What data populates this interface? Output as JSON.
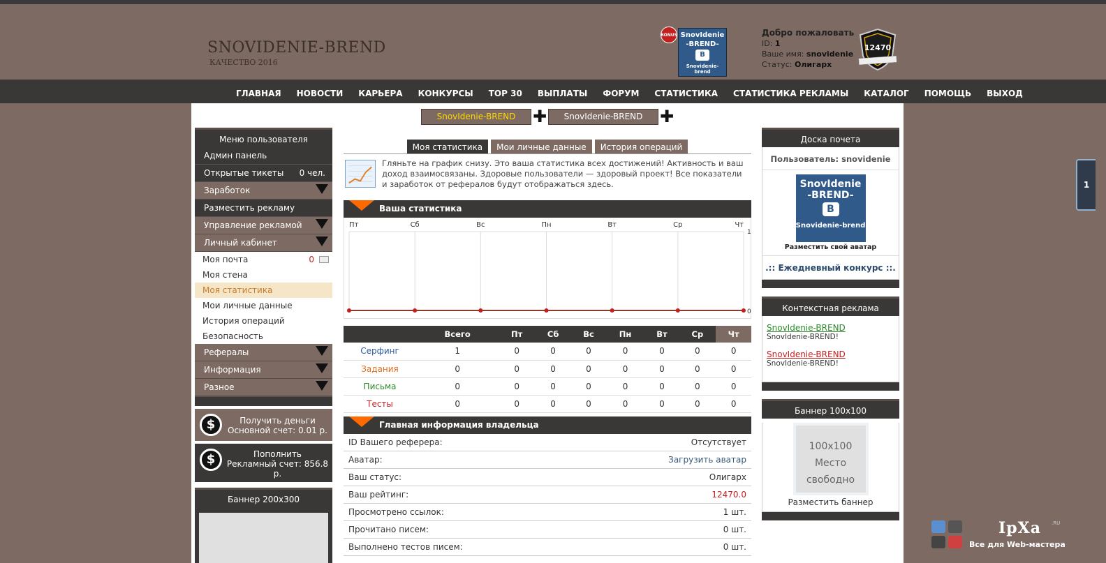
{
  "header": {
    "site_title": "SNOVIDENIE-BREND",
    "site_subtitle": "КАЧЕСТВО 2016",
    "bonus_badge": "BONUS",
    "thumb_line1": "SnovIdenie",
    "thumb_line2": "-BREND-",
    "thumb_letter": "B",
    "thumb_line3": "Snovidenie-brend",
    "welcome_title": "Добро пожаловать",
    "id_label": "ID:",
    "id_value": "1",
    "name_label": "Ваше имя:",
    "name_value": "snovidenie",
    "status_label": "Статус:",
    "status_value": "Олигарх",
    "rating_badge": "12470"
  },
  "nav": {
    "items": [
      "ГЛАВНАЯ",
      "НОВОСТИ",
      "КАРЬЕРА",
      "КОНКУРСЫ",
      "TOP 30",
      "ВЫПЛАТЫ",
      "ФОРУМ",
      "СТАТИСТИКА",
      "СТАТИСТИКА РЕКЛАМЫ",
      "КАТАЛОГ",
      "ПОМОЩЬ",
      "ВЫХОД"
    ]
  },
  "toplinks": {
    "link1": "SnovIdenie-BREND",
    "link2": "SnovIdenie-BREND",
    "plus": "✚"
  },
  "left_menu": {
    "title": "Меню пользователя",
    "admin": "Админ панель",
    "tickets": "Открытые тикеты",
    "tickets_count": "0 чел.",
    "earnings": "Заработок",
    "place_ad": "Разместить рекламу",
    "manage_ads": "Управление рекламой",
    "cabinet": "Личный кабинет",
    "mail": "Моя почта",
    "mail_count": "0",
    "wall": "Моя стена",
    "stats": "Моя статистика",
    "personal": "Мои личные данные",
    "history": "История операций",
    "security": "Безопасность",
    "referrals": "Рефералы",
    "info": "Информация",
    "misc": "Разное"
  },
  "money": {
    "get_title": "Получить деньги",
    "get_sub": "Основной счет: 0.01 р.",
    "topup_title": "Пополнить",
    "topup_sub": "Рекламный счет: 856.8 р.",
    "dollar": "$"
  },
  "banner200": {
    "title": "Баннер 200x300"
  },
  "center": {
    "tabs": [
      "Моя статистика",
      "Мои личные данные",
      "История операций"
    ],
    "intro": "Гляньте на график снизу. Это ваша статистика всех достижений! Активность и ваш доход взаимосвязаны. Здоровые пользователи — здоровый проект! Все показатели и заработок от рефералов будут отображаться здесь.",
    "stats_title": "Ваша статистика",
    "owner_title": "Главная информация владельца"
  },
  "chart_data": {
    "type": "line",
    "categories": [
      "Пт",
      "Сб",
      "Вс",
      "Пн",
      "Вт",
      "Ср",
      "Чт"
    ],
    "series": [
      {
        "values": [
          0,
          0,
          0,
          0,
          0,
          0,
          0
        ]
      }
    ],
    "ylim": [
      0,
      1
    ],
    "y_ticks": [
      "0",
      "1"
    ],
    "grid": true,
    "line_color": "#8b3a2a",
    "point_color": "#c41f1f"
  },
  "stat_table": {
    "headers": [
      "",
      "Всего",
      "Пт",
      "Сб",
      "Вс",
      "Пн",
      "Вт",
      "Ср",
      "Чт"
    ],
    "rows": [
      {
        "label": "Серфинг",
        "color": "#2c5aa0",
        "values": [
          "1",
          "0",
          "0",
          "0",
          "0",
          "0",
          "0",
          "0"
        ]
      },
      {
        "label": "Задания",
        "color": "#e07020",
        "values": [
          "0",
          "0",
          "0",
          "0",
          "0",
          "0",
          "0",
          "0"
        ]
      },
      {
        "label": "Письма",
        "color": "#2a8a2a",
        "values": [
          "0",
          "0",
          "0",
          "0",
          "0",
          "0",
          "0",
          "0"
        ]
      },
      {
        "label": "Тесты",
        "color": "#c41f1f",
        "values": [
          "0",
          "0",
          "0",
          "0",
          "0",
          "0",
          "0",
          "0"
        ]
      }
    ]
  },
  "owner": {
    "rows": [
      {
        "label": "ID Вашего реферера:",
        "value": "Отсутствует",
        "style": ""
      },
      {
        "label": "Аватар:",
        "value": "Загрузить аватар",
        "style": "link"
      },
      {
        "label": "Ваш статус:",
        "value": "Олигарх",
        "style": ""
      },
      {
        "label": "Ваш рейтинг:",
        "value": "12470.0",
        "style": "red"
      },
      {
        "label": "Просмотрено ссылок:",
        "value": "1 шт.",
        "style": ""
      },
      {
        "label": "Прочитано писем:",
        "value": "0 шт.",
        "style": ""
      },
      {
        "label": "Выполнено тестов писем:",
        "value": "0 шт.",
        "style": ""
      }
    ]
  },
  "right": {
    "honor_title": "Доска почета",
    "honor_user": "Пользователь: snovidenie",
    "honor_img_line1": "SnovIdenie",
    "honor_img_line2": "-BREND-",
    "honor_img_letter": "B",
    "honor_img_line3": "Snovidenie-brend",
    "honor_caption": "Разместить свой аватар",
    "contest": ".:: Ежедневный конкурс ::.",
    "context_title": "Контекстная реклама",
    "ctx1_link": "SnovIdenie-BREND",
    "ctx1_desc": "SnovIdenie-BREND!",
    "ctx2_link": "SnovIdenie-BREND",
    "ctx2_desc": "SnovIdenie-BREND!",
    "b100_title": "Баннер 100x100",
    "b100_line1": "100x100",
    "b100_line2": "Место",
    "b100_line3": "свободно",
    "b100_caption": "Разместить баннер"
  },
  "side_tab": {
    "label": "1"
  },
  "watermark": {
    "title": "IpXa",
    "ru": ".RU",
    "sub": "Все для Web-мастера"
  }
}
